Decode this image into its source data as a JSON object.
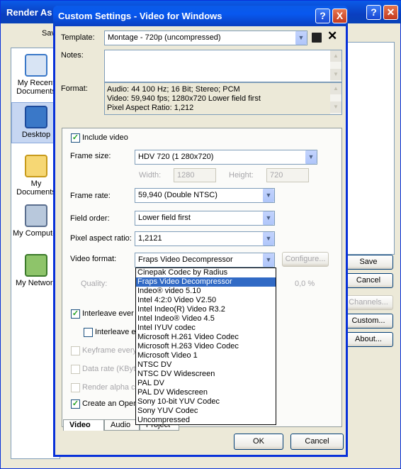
{
  "background_window": {
    "title": "Render As",
    "save_in_label": "Save",
    "places": [
      "My Recent Documents",
      "Desktop",
      "My Documents",
      "My Computer",
      "My Network"
    ],
    "buttons": {
      "save": "Save",
      "cancel": "Cancel",
      "channels": "Channels...",
      "custom": "Custom...",
      "about": "About..."
    }
  },
  "dialog": {
    "title": "Custom Settings - Video for Windows",
    "help_glyph": "?",
    "close_glyph": "X",
    "template_label": "Template:",
    "template_value": "Montage - 720p (uncompressed)",
    "notes_label": "Notes:",
    "notes_value": "",
    "format_label": "Format:",
    "format_lines": [
      "Audio: 44 100 Hz; 16 Bit; Stereo; PCM",
      "Video: 59,940 fps; 1280x720 Lower field first",
      "Pixel Aspect Ratio: 1,212"
    ],
    "include_video_label": "Include video",
    "frame_size_label": "Frame size:",
    "frame_size_value": "HDV 720 (1 280x720)",
    "width_label": "Width:",
    "width_value": "1280",
    "height_label": "Height:",
    "height_value": "720",
    "frame_rate_label": "Frame rate:",
    "frame_rate_value": "59,940 (Double NTSC)",
    "field_order_label": "Field order:",
    "field_order_value": "Lower field first",
    "pixel_aspect_label": "Pixel aspect ratio:",
    "pixel_aspect_value": "1,2121",
    "video_format_label": "Video format:",
    "video_format_value": "Fraps Video Decompressor",
    "configure_label": "Configure...",
    "quality_label": "Quality:",
    "quality_value": "0,0 %",
    "interleave_label": "Interleave ever",
    "interleave2_label": "Interleave e",
    "keyframe_label": "Keyframe every",
    "datarate_label": "Data rate (KByt",
    "render_alpha_label": "Render alpha c",
    "create_label": "Create an Open",
    "video_format_options": [
      "Cinepak Codec by Radius",
      "Fraps Video Decompressor",
      "Indeo® video 5.10",
      "Intel 4:2:0 Video V2.50",
      "Intel Indeo(R) Video R3.2",
      "Intel Indeo® Video 4.5",
      "Intel IYUV codec",
      "Microsoft H.261 Video Codec",
      "Microsoft H.263 Video Codec",
      "Microsoft Video 1",
      "NTSC DV",
      "NTSC DV Widescreen",
      "PAL DV",
      "PAL DV Widescreen",
      "Sony 10-bit YUV Codec",
      "Sony YUV Codec",
      "Uncompressed"
    ],
    "selected_option_index": 1,
    "tabs": [
      "Video",
      "Audio",
      "Project"
    ],
    "ok_label": "OK",
    "cancel_label": "Cancel"
  }
}
